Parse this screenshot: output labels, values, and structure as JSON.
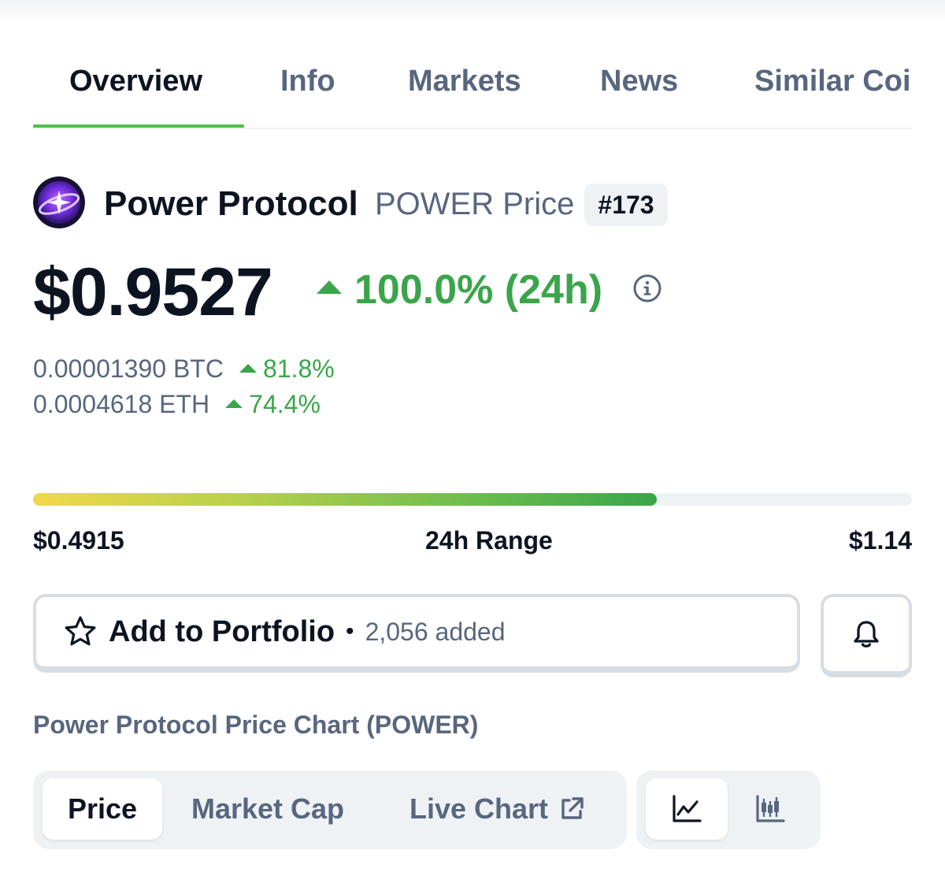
{
  "tabs": [
    {
      "label": "Overview",
      "active": true
    },
    {
      "label": "Info",
      "active": false
    },
    {
      "label": "Markets",
      "active": false
    },
    {
      "label": "News",
      "active": false
    },
    {
      "label": "Similar Coi",
      "active": false
    }
  ],
  "coin": {
    "name": "Power Protocol",
    "subtitle": "POWER Price",
    "rank": "#173",
    "price": "$0.9527",
    "change_24h": "100.0% (24h)",
    "btc": {
      "value": "0.00001390 BTC",
      "change": "81.8%"
    },
    "eth": {
      "value": "0.0004618 ETH",
      "change": "74.4%"
    }
  },
  "range": {
    "low": "$0.4915",
    "label": "24h Range",
    "high": "$1.14",
    "position_fraction": 0.71
  },
  "portfolio": {
    "label": "Add to Portfolio",
    "separator": "•",
    "count": "2,056 added"
  },
  "chart_section": {
    "title": "Power Protocol Price Chart (POWER)",
    "tabs": [
      {
        "label": "Price",
        "active": true
      },
      {
        "label": "Market Cap",
        "active": false
      },
      {
        "label": "Live Chart",
        "active": false
      }
    ],
    "chart_types": [
      {
        "icon": "line-chart-icon",
        "active": true
      },
      {
        "icon": "candlestick-chart-icon",
        "active": false
      }
    ]
  },
  "colors": {
    "accent_green": "#4fbf4b",
    "positive": "#3aa54a",
    "text_primary": "#0d1421",
    "text_secondary": "#58667e"
  }
}
